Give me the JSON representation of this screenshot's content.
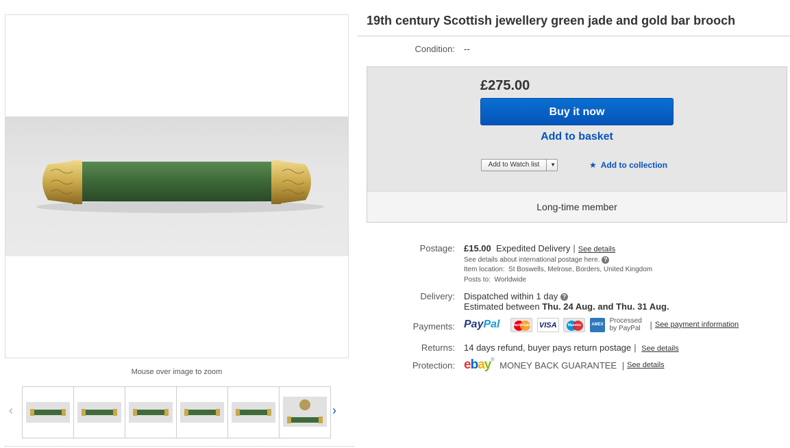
{
  "title": "19th century Scottish jewellery green jade and gold bar brooch",
  "condition": {
    "label": "Condition:",
    "value": "--"
  },
  "buybox": {
    "price": "£275.00",
    "buy_now_label": "Buy it now",
    "add_basket_label": "Add to basket",
    "watch_list_label": "Add to Watch list",
    "add_collection_label": "Add to collection",
    "member_label": "Long-time member"
  },
  "postage": {
    "label": "Postage:",
    "cost": "£15.00",
    "method": "Expedited Delivery",
    "see_details": "See details",
    "international": "See details about international postage here.",
    "item_location_label": "Item location:",
    "item_location": "St Boswells, Melrose, Borders, United Kingdom",
    "posts_to_label": "Posts to:",
    "posts_to": "Worldwide"
  },
  "delivery": {
    "label": "Delivery:",
    "dispatch": "Dispatched within 1 day",
    "estimated_prefix": "Estimated between",
    "estimated_range": "Thu. 24 Aug. and Thu. 31 Aug."
  },
  "payments": {
    "label": "Payments:",
    "paypal_a": "Pay",
    "paypal_b": "Pal",
    "processed_line1": "Processed",
    "processed_line2": "by PayPal",
    "see_payment": "See payment information",
    "card_mastercard": "MasterCard",
    "card_visa": "VISA",
    "card_maestro": "Maestro",
    "card_amex": "AMEX",
    "cards": [
      "mastercard-icon",
      "visa-icon",
      "maestro-icon",
      "amex-icon"
    ]
  },
  "returns": {
    "label": "Returns:",
    "text": "14 days refund, buyer pays return postage",
    "see_details": "See details"
  },
  "protection": {
    "label": "Protection:",
    "ebay_e": "e",
    "ebay_b": "b",
    "ebay_a": "a",
    "ebay_y": "y",
    "guarantee": "MONEY BACK GUARANTEE",
    "see_details": "See details"
  },
  "gallery": {
    "zoom_hint": "Mouse over image to zoom",
    "thumb_count": 6
  },
  "colors": {
    "link_blue": "#0654ba",
    "jade": "#3f6b3a",
    "gold": "#c9a84a"
  }
}
